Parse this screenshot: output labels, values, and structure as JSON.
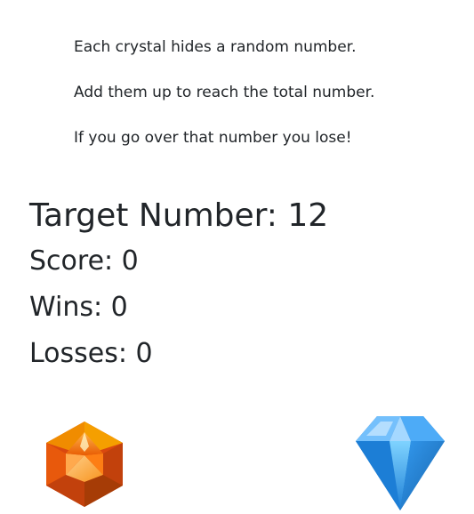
{
  "instructions": {
    "line1": "Each crystal hides a random number.",
    "line2": "Add them up to reach the total number.",
    "line3": "If you go over that number you lose!"
  },
  "stats": {
    "target_label": "Target Number: 12",
    "score_label": "Score: 0",
    "wins_label": "Wins: 0",
    "losses_label": "Losses: 0"
  },
  "crystals": [
    {
      "name": "orange-crystal",
      "color": "#f07a17"
    },
    {
      "name": "blue-crystal",
      "color": "#1e88e5"
    }
  ],
  "colors": {
    "text": "#212529",
    "background": "#ffffff"
  }
}
